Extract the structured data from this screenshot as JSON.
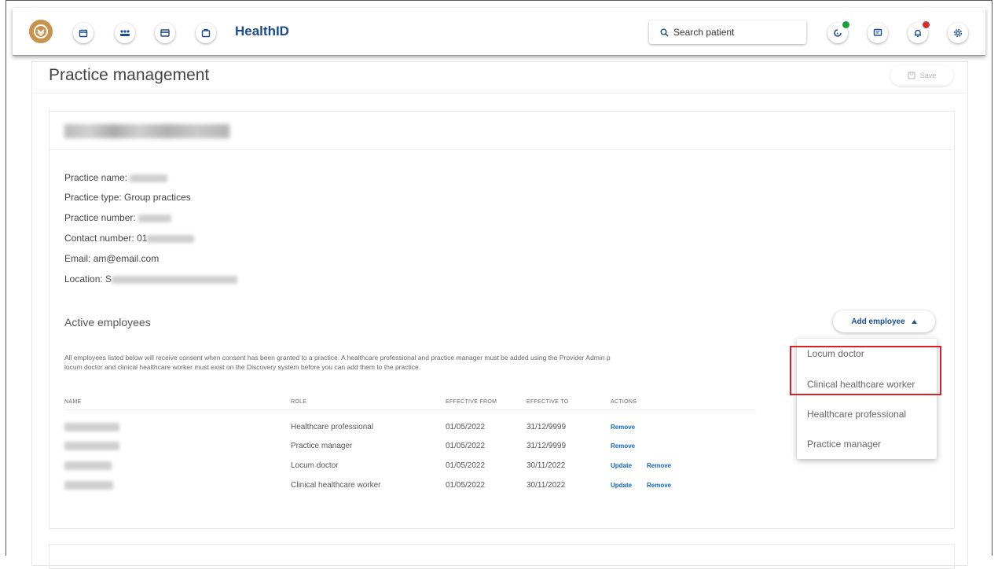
{
  "header": {
    "brand": "HealthID",
    "search_placeholder": "Search patient",
    "notification_colors": {
      "status": "#1e9e3a",
      "alert": "#d32f2f"
    }
  },
  "page": {
    "title": "Practice management",
    "save_label": "Save"
  },
  "practice": {
    "name_label": "Practice name:",
    "type_label": "Practice type:",
    "type_value": "Group practices",
    "number_label": "Practice number:",
    "contact_label": "Contact number:",
    "contact_prefix": "01",
    "email_label": "Email:",
    "email_value": "am@email.com",
    "location_label": "Location:",
    "location_prefix": "S"
  },
  "employees": {
    "title": "Active employees",
    "add_label": "Add employee",
    "notice": "All employees listed below will receive consent when consent has been granted to a practice. A healthcare professional and practice manager must be added using the Provider Admin p",
    "notice_line2": "locum doctor and clinical healthcare worker must exist on the Discovery system before you can add them to the practice.",
    "columns": [
      "NAME",
      "ROLE",
      "EFFECTIVE FROM",
      "EFFECTIVE TO",
      "ACTIONS"
    ],
    "rows": [
      {
        "role": "Healthcare professional",
        "from": "01/05/2022",
        "to": "31/12/9999",
        "actions": [
          "Remove"
        ]
      },
      {
        "role": "Practice manager",
        "from": "01/05/2022",
        "to": "31/12/9999",
        "actions": [
          "Remove"
        ]
      },
      {
        "role": "Locum doctor",
        "from": "01/05/2022",
        "to": "30/11/2022",
        "actions": [
          "Update",
          "Remove"
        ]
      },
      {
        "role": "Clinical healthcare worker",
        "from": "01/05/2022",
        "to": "30/11/2022",
        "actions": [
          "Update",
          "Remove"
        ]
      }
    ]
  },
  "dropdown": {
    "items": [
      "Locum doctor",
      "Clinical healthcare worker",
      "Healthcare professional",
      "Practice manager"
    ]
  }
}
